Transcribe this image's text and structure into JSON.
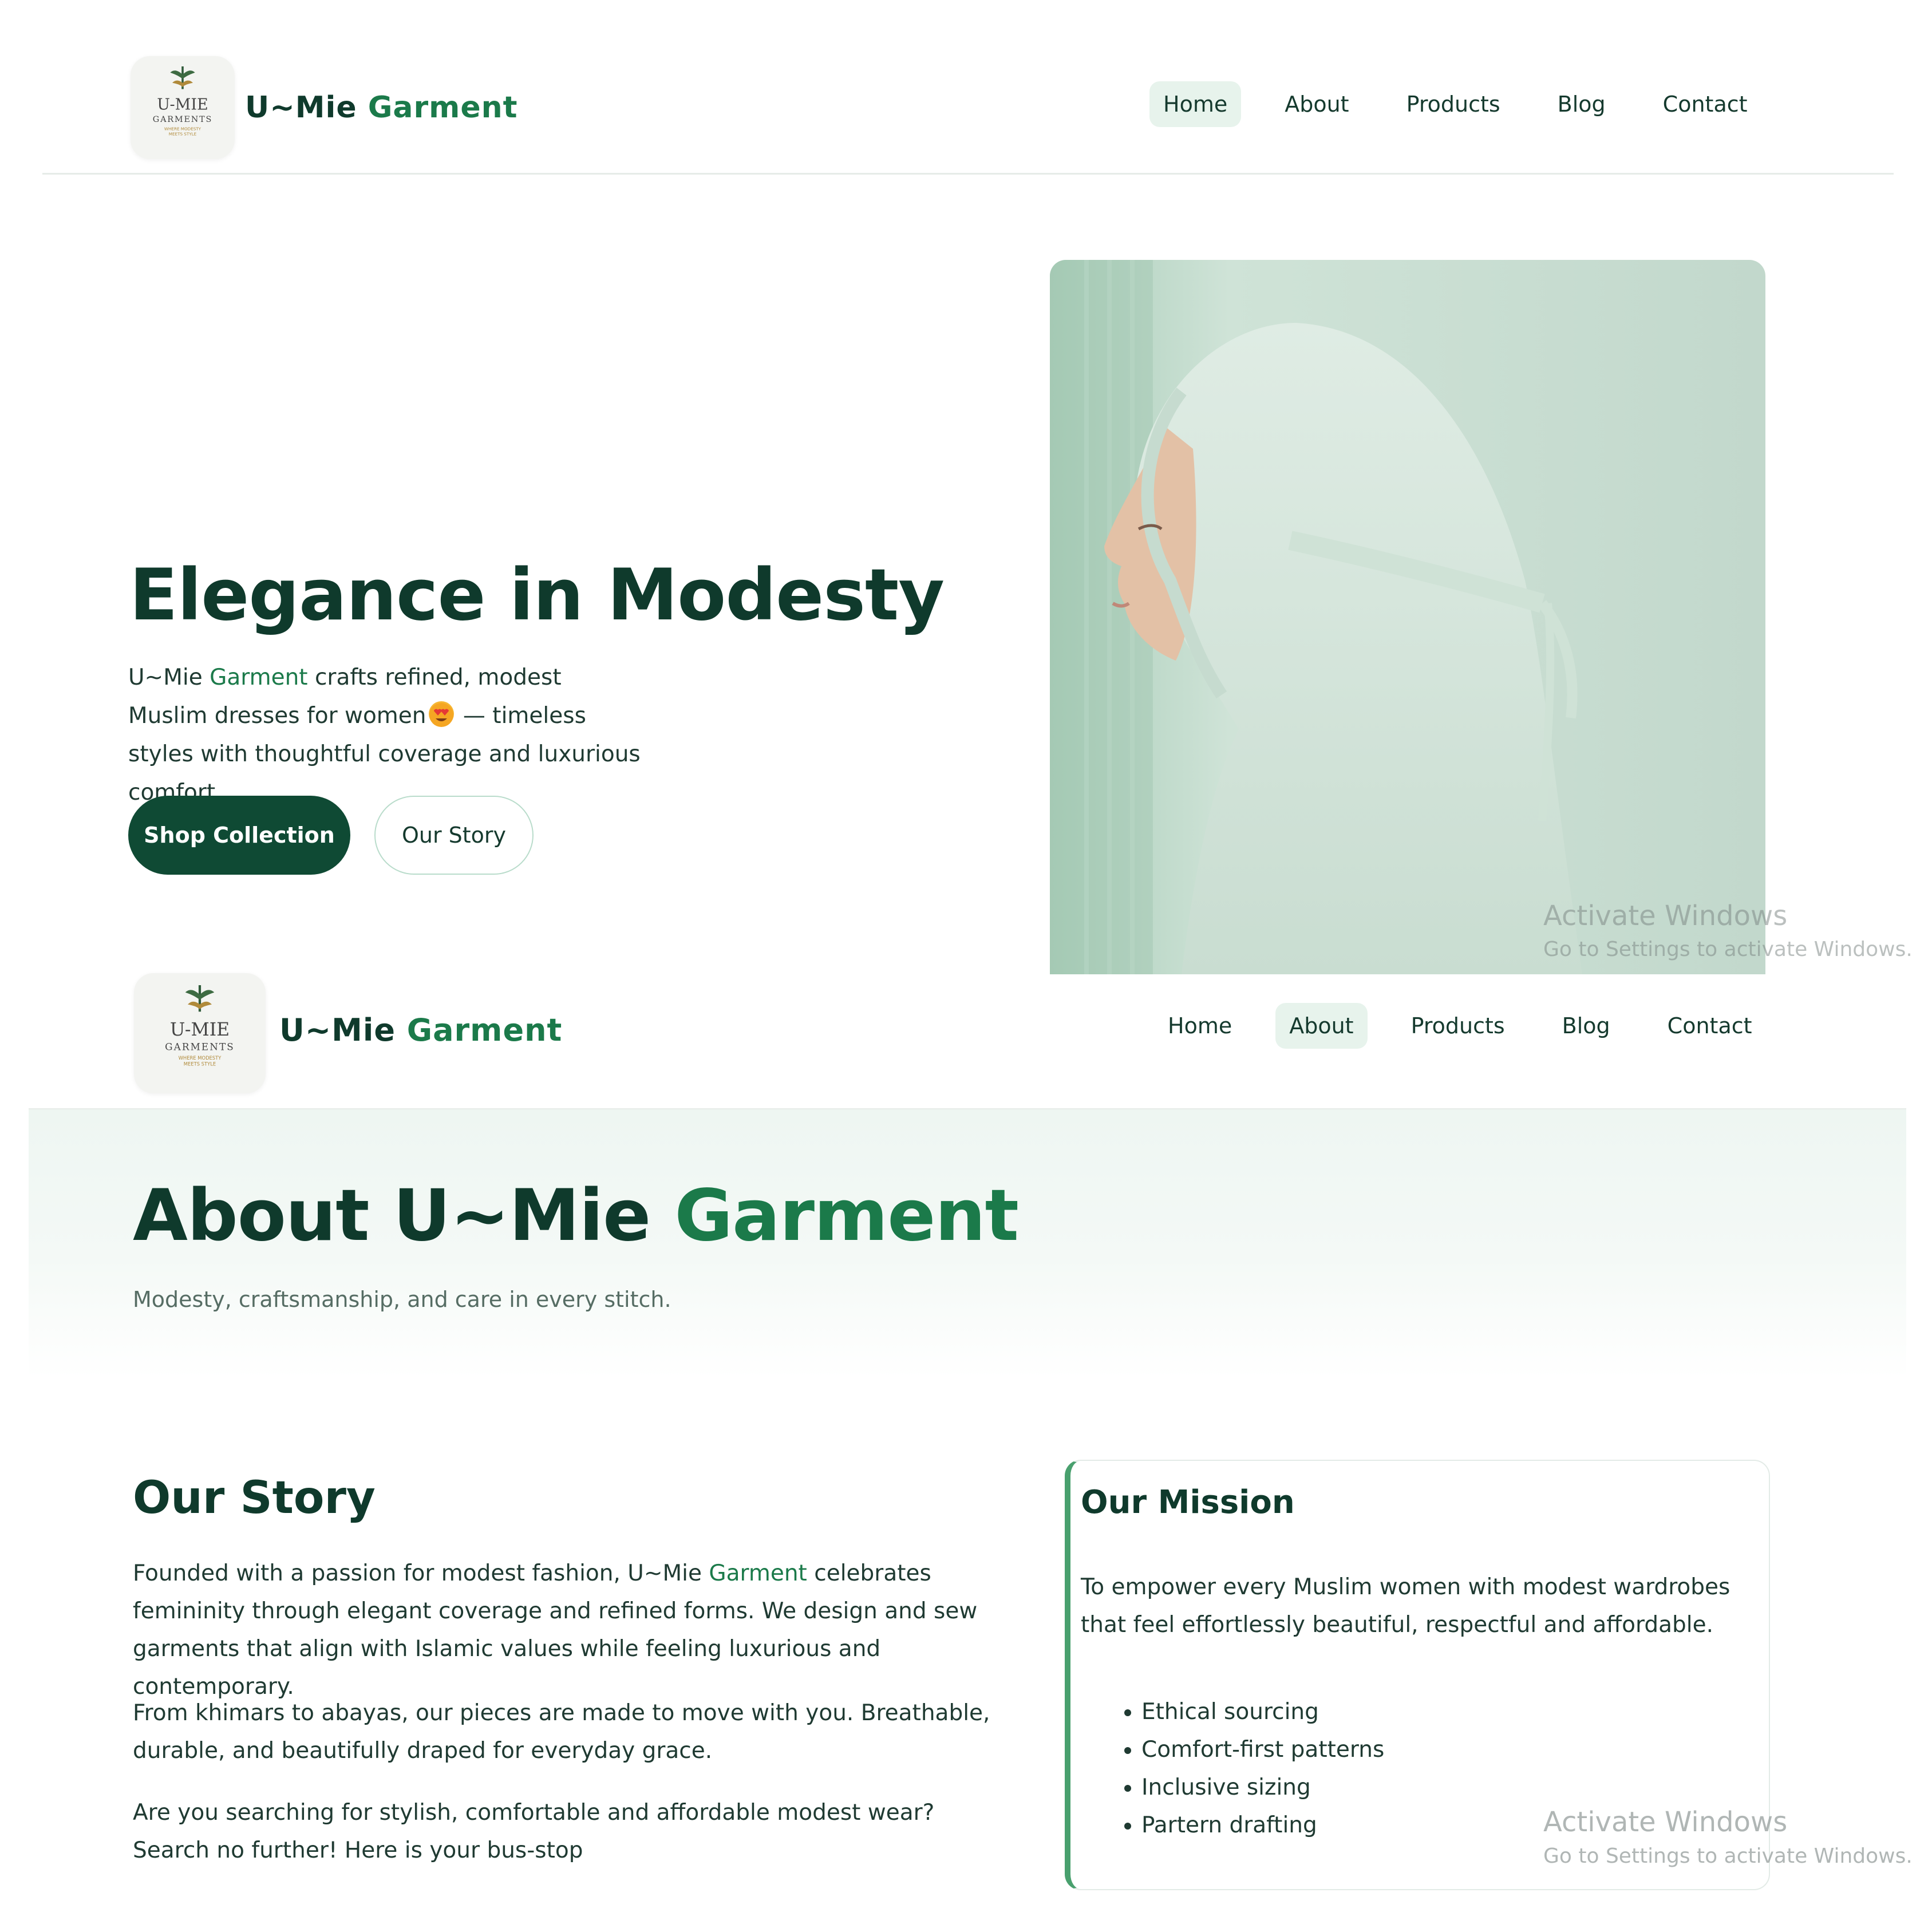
{
  "brand": {
    "part1": "U~Mie",
    "part2": "Garment"
  },
  "logo": {
    "line1": "U-MIE",
    "line2": "GARMENTS",
    "tagline1": "WHERE MODESTY",
    "tagline2": "MEETS STYLE"
  },
  "nav": {
    "home": "Home",
    "about": "About",
    "products": "Products",
    "blog": "Blog",
    "contact": "Contact",
    "active_first": "Home",
    "active_second": "About"
  },
  "hero": {
    "title": "Elegance in Modesty",
    "desc_prefix": "U~Mie ",
    "desc_accent": "Garment",
    "desc_mid": " crafts refined, modest Muslim dresses for women",
    "desc_suffix": " — timeless styles with thoughtful coverage and luxurious comfort.",
    "primary_button": "Shop Collection",
    "secondary_button": "Our Story",
    "image_icon": "woman-hijab-photo"
  },
  "about": {
    "title_prefix": "About U~Mie ",
    "title_accent": "Garment",
    "subtitle": "Modesty, craftsmanship, and care in every stitch."
  },
  "story": {
    "title": "Our Story",
    "p1_prefix": "Founded with a passion for modest fashion, U~Mie ",
    "p1_accent": "Garment",
    "p1_suffix": " celebrates femininity through elegant coverage and refined forms. We design and sew garments that align with Islamic values while feeling luxurious and contemporary.",
    "p2": "From khimars to abayas, our pieces are made to move with you. Breathable, durable, and beautifully draped for everyday grace.",
    "p3": "Are you searching for stylish, comfortable and affordable modest wear? Search no further! Here is your bus-stop"
  },
  "mission": {
    "title": "Our Mission",
    "text": "To empower every Muslim women with modest wardrobes that feel effortlessly beautiful, respectful and affordable.",
    "items": [
      "Ethical sourcing",
      "Comfort-first patterns",
      "Inclusive sizing",
      "Partern drafting"
    ]
  },
  "watermark": {
    "line1": "Activate Windows",
    "line2": "Go to Settings to activate Windows."
  },
  "colors": {
    "primary": "#0f4a34",
    "accent": "#1b7a4a",
    "heading": "#0f3a2c",
    "mint": "#e7f3ec"
  }
}
